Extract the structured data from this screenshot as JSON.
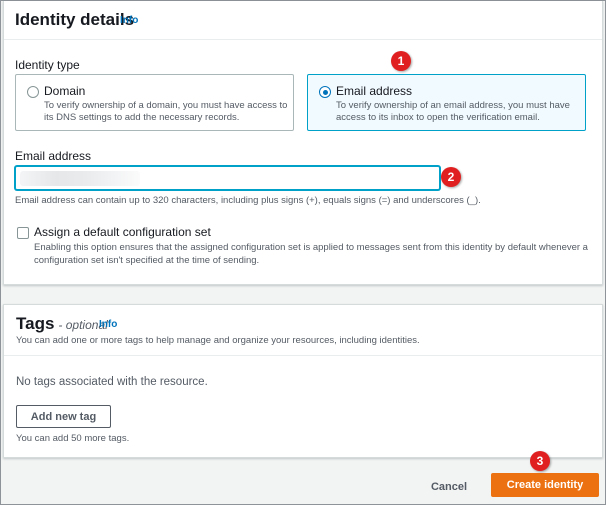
{
  "identity_details": {
    "title": "Identity details",
    "info": "Info",
    "identity_type_label": "Identity type",
    "options": [
      {
        "title": "Domain",
        "description": "To verify ownership of a domain, you must have access to its DNS settings to add the necessary records.",
        "selected": false
      },
      {
        "title": "Email address",
        "description": "To verify ownership of an email address, you must have access to its inbox to open the verification email.",
        "selected": true
      }
    ],
    "email_label": "Email address",
    "email_value": "",
    "email_hint": "Email address can contain up to 320 characters, including plus signs (+), equals signs (=) and underscores (_).",
    "default_config": {
      "label": "Assign a default configuration set",
      "description": "Enabling this option ensures that the assigned configuration set is applied to messages sent from this identity by default whenever a configuration set isn't specified at the time of sending.",
      "checked": false
    }
  },
  "tags": {
    "title": "Tags",
    "optional": "- optional",
    "info": "Info",
    "description": "You can add one or more tags to help manage and organize your resources, including identities.",
    "empty_text": "No tags associated with the resource.",
    "add_button": "Add new tag",
    "limit_text": "You can add 50 more tags."
  },
  "footer": {
    "cancel": "Cancel",
    "create": "Create identity"
  },
  "steps": [
    "1",
    "2",
    "3"
  ],
  "colors": {
    "primary": "#ec7211",
    "link": "#0073bb",
    "selected_border": "#00a1c9",
    "step_marker": "#e02020"
  }
}
